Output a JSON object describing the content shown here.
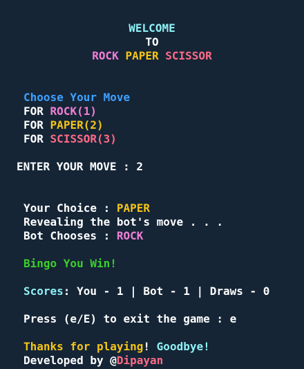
{
  "banner": {
    "line1": "WELCOME",
    "line2": "TO",
    "rock": "ROCK",
    "paper": "PAPER",
    "scissor": "SCISSOR"
  },
  "menu": {
    "title": "Choose Your Move",
    "for": "FOR",
    "rock": "ROCK(1)",
    "paper": "PAPER(2)",
    "scissor": "SCISSOR(3)"
  },
  "input": {
    "prompt": "ENTER YOUR MOVE : ",
    "value": "2"
  },
  "result": {
    "your_choice_label": "Your Choice : ",
    "your_choice_value": "PAPER",
    "revealing": "Revealing the bot's move . . .",
    "bot_label": "Bot Chooses : ",
    "bot_value": "ROCK",
    "outcome": "Bingo You Win!"
  },
  "scores": {
    "label": "Scores",
    "rest": ": You - 1 | Bot - 1 | Draws - 0"
  },
  "exit": {
    "prompt": "Press (e/E) to exit the game : ",
    "value": "e"
  },
  "footer": {
    "thanks": "Thanks for playing",
    "bang": "!",
    "goodbye": "Goodbye!",
    "developed": "Developed by @",
    "author": "Dipayan"
  },
  "colors": {
    "background": "#152536",
    "cyan": "#8ff0f5",
    "yellow": "#f5c518",
    "pink": "#f07fd5",
    "red": "#ff6b86",
    "blue": "#3ea0ff",
    "green": "#3ccf2a"
  }
}
